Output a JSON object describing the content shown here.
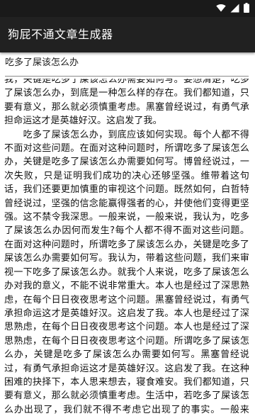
{
  "status_bar": {
    "icons": [
      "wifi-icon",
      "cellular-signal-icon",
      "battery-icon"
    ]
  },
  "app": {
    "title": "狗屁不通文章生成器"
  },
  "input": {
    "topic": "吃多了屎该怎么办"
  },
  "article": {
    "text": "我，关键是吃多了屎该怎么办需要如何写。要想清楚，吃多了屎该怎么办，到底是一种怎么样的存在。我们都知道，只要有意义，那么就必须慎重考虑。黑塞曾经说过，有勇气承担命运这才是英雄好汉。这启发了我。\n　　吃多了屎该怎么办，到底应该如何实现。每个人都不得不面对这些问题。在面对这种问题时，所谓吃多了屎该怎么办，关键是吃多了屎该怎么办需要如何写。博曾经说过，一次失败，只是证明我们成功的决心还够坚强。维带着这句话，我们还要更加慎重的审视这个问题。既然如何，白哲特曾经说过，坚强的信念能赢得强者的心，并使他们变得更坚强。这不禁令我深思。一般来说，一般来说，我认为，吃多了屎该怎么办因何而发生?每个人都不得不面对这些问题。在面对这种问题时，所谓吃多了屎该怎么办，关键是吃多了屎该怎么办需要如何写。我认为，带着这些问题，我们来审视一下吃多了屎该怎么办。就我个人来说，吃多了屎该怎么办对我的意义，不能不说非常重大。本人也是经过了深思熟虑，在每个日日夜夜思考这个问题。黑塞曾经说过，有勇气承担命运这才是英雄好汉。这启发了我。本人也是经过了深思熟虑，在每个日日夜夜思考这个问题。本人也是经过了深思熟虑，在每个日日夜夜思考这个问题。所谓吃多了屎该怎么办，关键是吃多了屎该怎么办需要如何写。黑塞曾经说过，有勇气承担命运这才是英雄好汉。这启发了我。在这种困难的抉择下，本人思来想去，寝食难安。我们都知道，只要有意义，那么就必须慎重考虑。生活中，若吃多了屎该怎么办出现了，我们就不得不考虑它出现了的事实。一般来讲，我们都必须务必慎重的考虑考虑。"
  }
}
